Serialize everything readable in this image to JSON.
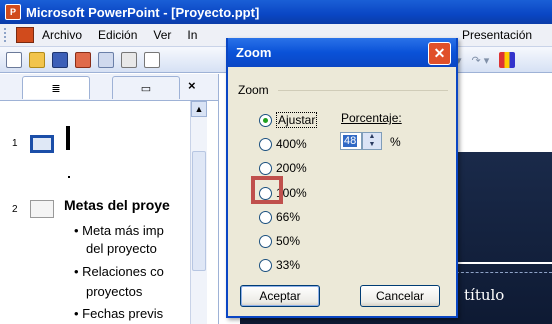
{
  "app": {
    "title": "Microsoft PowerPoint - [Proyecto.ppt]",
    "icon": "powerpoint-icon"
  },
  "menu": {
    "items": [
      "Archivo",
      "Edición",
      "Ver",
      "In",
      "Presentación"
    ]
  },
  "outline": {
    "slide1_num": "1",
    "slide2_num": "2",
    "slide2_title": "Metas del proye",
    "bullets": [
      "• Meta más imp",
      "del proyecto",
      "• Relaciones co",
      "proyectos",
      "• Fechas previs"
    ]
  },
  "slide": {
    "title": "título"
  },
  "dialog": {
    "title": "Zoom",
    "group_label": "Zoom",
    "options": [
      {
        "label": "Ajustar",
        "selected": true
      },
      {
        "label": "400%",
        "selected": false
      },
      {
        "label": "200%",
        "selected": false
      },
      {
        "label": "100%",
        "selected": false,
        "highlighted": true
      },
      {
        "label": "66%",
        "selected": false
      },
      {
        "label": "50%",
        "selected": false
      },
      {
        "label": "33%",
        "selected": false
      }
    ],
    "percentage_label": "Porcentaje:",
    "percentage_value": "48",
    "percent_sign": "%",
    "ok_label": "Aceptar",
    "cancel_label": "Cancelar"
  },
  "colors": {
    "title_bar": "#0a46c4",
    "close_button": "#e0502a",
    "highlight_box": "#c0504d"
  }
}
